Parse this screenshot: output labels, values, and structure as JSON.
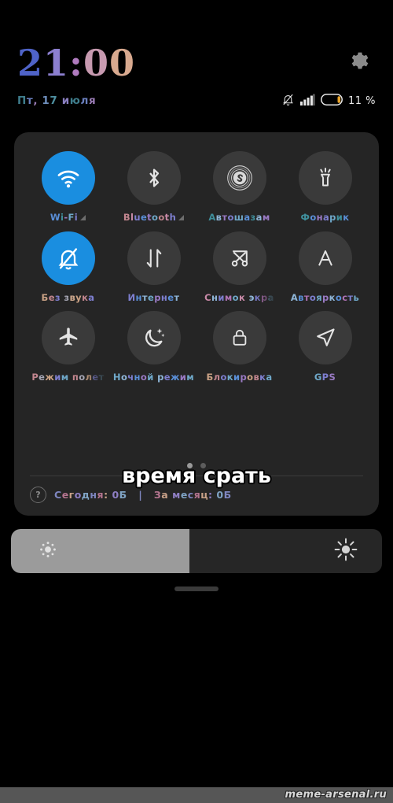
{
  "header": {
    "clock": "21:00",
    "date": "Пт, 17 июля",
    "gear_icon": "gear-icon",
    "status": {
      "mute_icon": "bell-muted-icon",
      "signal_icon": "signal-bars-icon",
      "battery_icon": "battery-icon",
      "battery_percent": "11 %"
    }
  },
  "quick_settings": {
    "rows": [
      [
        {
          "label": "Wi-Fi",
          "icon": "wifi-icon",
          "active": true,
          "expandable": true,
          "truncated": false
        },
        {
          "label": "Bluetooth",
          "icon": "bluetooth-icon",
          "active": false,
          "expandable": true,
          "truncated": false
        },
        {
          "label": "Автошазам",
          "icon": "shazam-icon",
          "active": false,
          "expandable": false,
          "truncated": false
        },
        {
          "label": "Фонарик",
          "icon": "flashlight-icon",
          "active": false,
          "expandable": false,
          "truncated": false
        }
      ],
      [
        {
          "label": "Без звука",
          "icon": "bell-muted-icon",
          "active": true,
          "expandable": false,
          "truncated": false
        },
        {
          "label": "Интернет",
          "icon": "data-transfer-icon",
          "active": false,
          "expandable": false,
          "truncated": false
        },
        {
          "label": "Снимок экра",
          "icon": "screenshot-scissors-icon",
          "active": false,
          "expandable": false,
          "truncated": true
        },
        {
          "label": "Автояркость",
          "icon": "auto-brightness-icon",
          "active": false,
          "expandable": false,
          "truncated": false
        }
      ],
      [
        {
          "label": "Режим полет",
          "icon": "airplane-icon",
          "active": false,
          "expandable": false,
          "truncated": true
        },
        {
          "label": "Ночной режим",
          "icon": "moon-icon",
          "active": false,
          "expandable": false,
          "truncated": false
        },
        {
          "label": "Блокировка",
          "icon": "lock-icon",
          "active": false,
          "expandable": false,
          "truncated": false
        },
        {
          "label": "GPS",
          "icon": "navigation-arrow-icon",
          "active": false,
          "expandable": false,
          "truncated": false
        }
      ]
    ],
    "page_dots": {
      "count": 2,
      "active_index": 0
    },
    "traffic": {
      "help_icon": "question-mark-icon",
      "today_label": "Сегодня: 0Б",
      "separator": "|",
      "month_label": "За месяц: 0Б"
    }
  },
  "meme_caption": "время срать",
  "brightness": {
    "value_percent": 48,
    "low_icon": "sun-small-icon",
    "high_icon": "sun-large-icon"
  },
  "drag_handle": "drag-handle",
  "watermark": "meme-arsenal.ru",
  "colors": {
    "accent_active": "#1a8ee0",
    "panel_bg": "#252525",
    "tile_bg": "#3a3a3a",
    "screen_bg": "#000000",
    "slider_fill": "#9b9b9b",
    "watermark_bar": "#565656"
  }
}
